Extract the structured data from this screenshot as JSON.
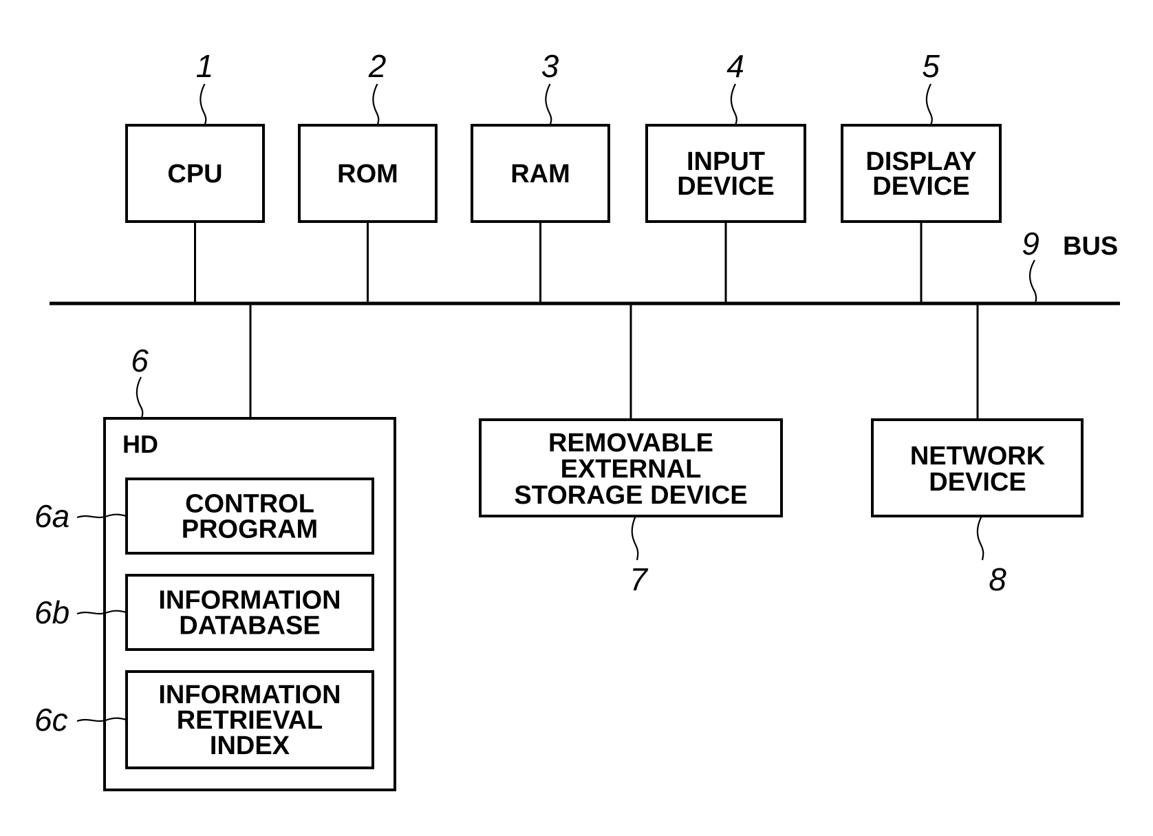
{
  "bus": {
    "ref": "9",
    "label": "BUS"
  },
  "top_blocks": [
    {
      "ref": "1",
      "lines": [
        "CPU"
      ]
    },
    {
      "ref": "2",
      "lines": [
        "ROM"
      ]
    },
    {
      "ref": "3",
      "lines": [
        "RAM"
      ]
    },
    {
      "ref": "4",
      "lines": [
        "INPUT",
        "DEVICE"
      ]
    },
    {
      "ref": "5",
      "lines": [
        "DISPLAY",
        "DEVICE"
      ]
    }
  ],
  "hd": {
    "ref": "6",
    "label": "HD",
    "items": [
      {
        "ref": "6a",
        "lines": [
          "CONTROL",
          "PROGRAM"
        ]
      },
      {
        "ref": "6b",
        "lines": [
          "INFORMATION",
          "DATABASE"
        ]
      },
      {
        "ref": "6c",
        "lines": [
          "INFORMATION",
          "RETRIEVAL",
          "INDEX"
        ]
      }
    ]
  },
  "removable": {
    "ref": "7",
    "lines": [
      "REMOVABLE",
      "EXTERNAL",
      "STORAGE DEVICE"
    ]
  },
  "network": {
    "ref": "8",
    "lines": [
      "NETWORK",
      "DEVICE"
    ]
  }
}
